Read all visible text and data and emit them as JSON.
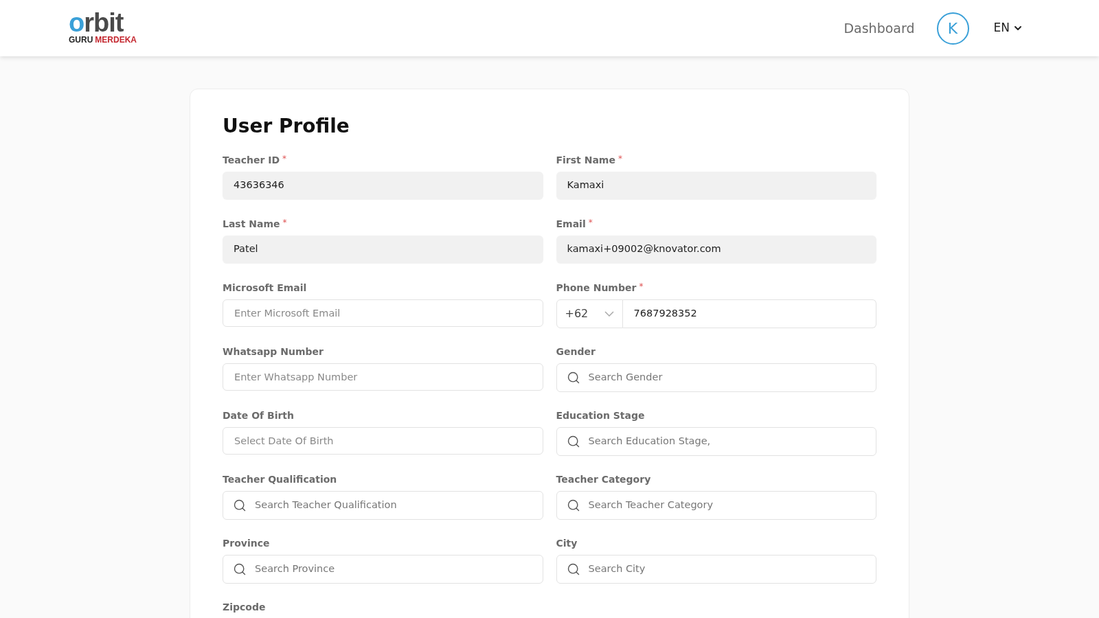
{
  "header": {
    "logo": {
      "wordmark": "orbit",
      "line_left": "GURU",
      "line_right": "MERDEKA"
    },
    "nav_link": "Dashboard",
    "avatar": "K",
    "language": "EN"
  },
  "profile": {
    "title": "User Profile",
    "fields": [
      {
        "label": "Teacher ID",
        "required_mark": "*",
        "kind": "readonly",
        "value": "43636346"
      },
      {
        "label": "First Name",
        "required_mark": "*",
        "kind": "readonly",
        "value": "Kamaxi"
      },
      {
        "label": "Last Name",
        "required_mark": "*",
        "kind": "readonly",
        "value": "Patel"
      },
      {
        "label": "Email",
        "required_mark": "*",
        "kind": "readonly",
        "value": "kamaxi+09002@knovator.com"
      },
      {
        "label": "Microsoft Email",
        "kind": "text",
        "placeholder": "Enter Microsoft Email"
      },
      {
        "label": "Phone Number",
        "required_mark": "*",
        "kind": "phone",
        "code": "+62",
        "value": "7687928352"
      },
      {
        "label": "Whatsapp Number",
        "kind": "text",
        "placeholder": "Enter Whatsapp Number"
      },
      {
        "label": "Gender",
        "kind": "search",
        "placeholder": "Search Gender"
      },
      {
        "label": "Date Of Birth",
        "kind": "text",
        "placeholder": "Select Date Of Birth"
      },
      {
        "label": "Education Stage",
        "kind": "search",
        "placeholder": "Search Education Stage,"
      },
      {
        "label": "Teacher Qualification",
        "kind": "search",
        "placeholder": "Search Teacher Qualification"
      },
      {
        "label": "Teacher Category",
        "kind": "search",
        "placeholder": "Search Teacher Category"
      },
      {
        "label": "Province",
        "kind": "search",
        "placeholder": "Search Province"
      },
      {
        "label": "City",
        "kind": "search",
        "placeholder": "Search City"
      },
      {
        "label": "Zipcode",
        "kind": "label_only"
      }
    ]
  }
}
